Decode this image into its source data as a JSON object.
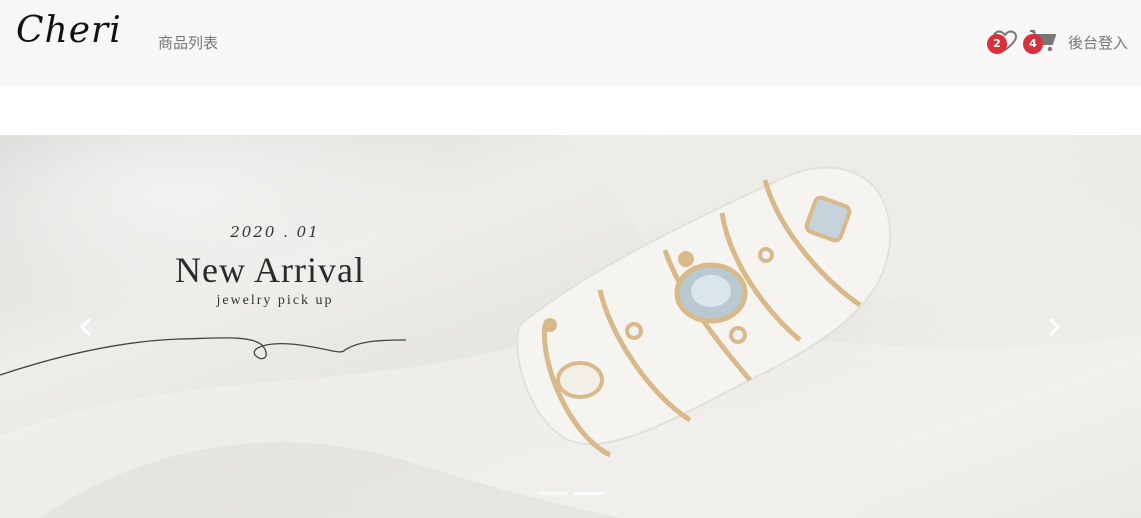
{
  "navbar": {
    "brand": "Cheri",
    "links": [
      {
        "label": "商品列表"
      }
    ],
    "favorites": {
      "icon": "heart-icon",
      "count": "2"
    },
    "cart": {
      "icon": "cart-icon",
      "count": "4"
    },
    "login_label": "後台登入"
  },
  "carousel": {
    "slide": {
      "date": "2020 . 01",
      "title": "New Arrival",
      "subtitle": "jewelry pick up"
    },
    "controls": {
      "prev_icon": "chevron-left-icon",
      "next_icon": "chevron-right-icon"
    },
    "indicators": [
      {
        "active": false
      },
      {
        "active": true
      }
    ]
  },
  "colors": {
    "navbar_bg": "#f8f6f6",
    "badge": "#d9313b",
    "nav_text": "#777777",
    "gold": "#d9b98a"
  }
}
